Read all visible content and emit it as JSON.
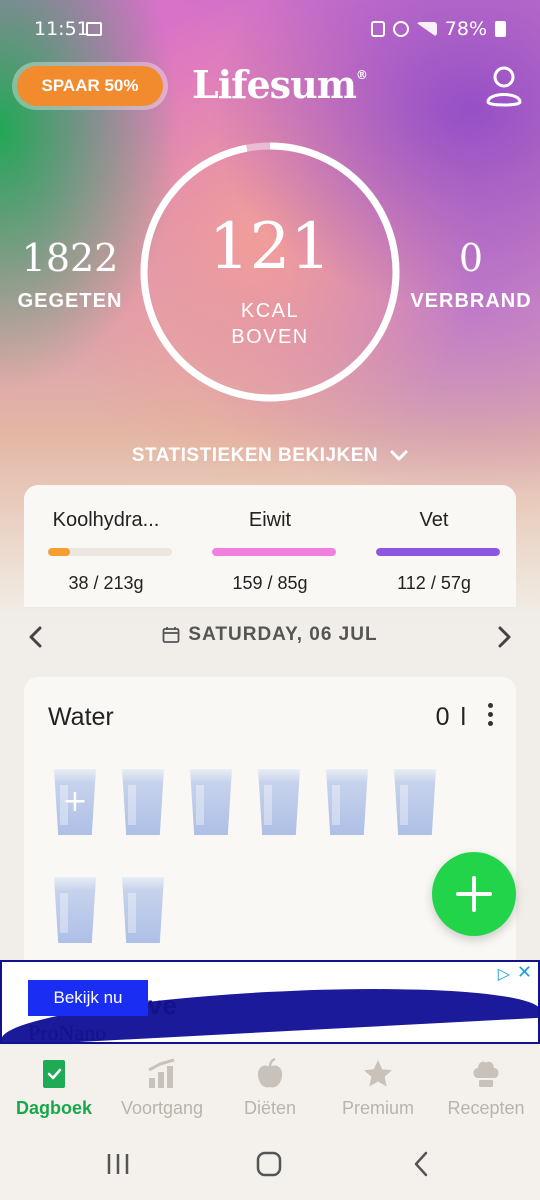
{
  "status_bar": {
    "time": "11:51",
    "battery": "78%"
  },
  "header": {
    "promo_label": "SPAAR 50%",
    "logo_text": "Lifesum",
    "logo_mark": "®"
  },
  "summary": {
    "eaten_value": "1822",
    "eaten_label": "GEGETEN",
    "center_value": "121",
    "center_label_1": "KCAL",
    "center_label_2": "BOVEN",
    "burned_value": "0",
    "burned_label": "VERBRAND",
    "ring_progress": 0.97,
    "stats_link": "STATISTIEKEN BEKIJKEN"
  },
  "macros": [
    {
      "name": "Koolhydra...",
      "amount": "38 / 213g",
      "progress": 0.18,
      "color": "#f5a02e"
    },
    {
      "name": "Eiwit",
      "amount": "159 / 85g",
      "progress": 1.0,
      "color": "#f07fe0"
    },
    {
      "name": "Vet",
      "amount": "112 / 57g",
      "progress": 1.0,
      "color": "#8d55e0"
    }
  ],
  "date_nav": {
    "date": "SATURDAY, 06 JUL"
  },
  "water": {
    "title": "Water",
    "amount": "0 l",
    "glasses": 8,
    "filled": 0
  },
  "ad": {
    "cta": "Bekijk nu",
    "brand_partial_1": "ve",
    "brand_partial_2": "ProNano"
  },
  "tabs": [
    {
      "label": "Dagboek",
      "icon": "diary-book-icon",
      "active": true
    },
    {
      "label": "Voortgang",
      "icon": "progress-chart-icon",
      "active": false
    },
    {
      "label": "Diëten",
      "icon": "apple-icon",
      "active": false
    },
    {
      "label": "Premium",
      "icon": "star-icon",
      "active": false
    },
    {
      "label": "Recepten",
      "icon": "chef-hat-icon",
      "active": false
    }
  ],
  "colors": {
    "accent_green": "#22d44a",
    "promo_orange": "#f28a2e",
    "tab_active": "#18a84a",
    "tab_inactive": "#b9b3ab"
  }
}
